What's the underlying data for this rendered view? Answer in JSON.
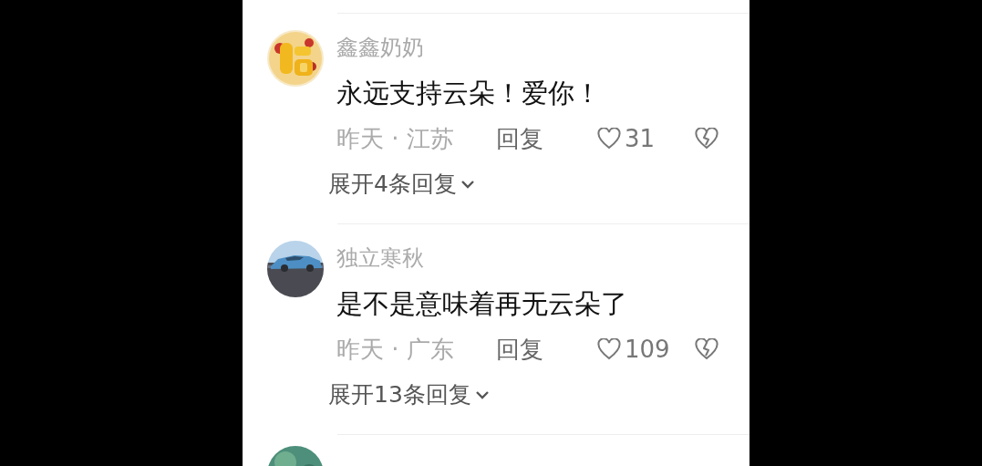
{
  "comments": [
    {
      "author": "鑫鑫奶奶",
      "text": "永远支持云朵！爱你！",
      "meta": "昨天 · 江苏",
      "reply": "回复",
      "likes": "31",
      "liked": false,
      "expand": "展开4条回复"
    },
    {
      "author": "独立寒秋",
      "text": "是不是意味着再无云朵了",
      "meta": "昨天 · 广东",
      "reply": "回复",
      "likes": "109",
      "liked": false,
      "expand": "展开13条回复"
    }
  ]
}
